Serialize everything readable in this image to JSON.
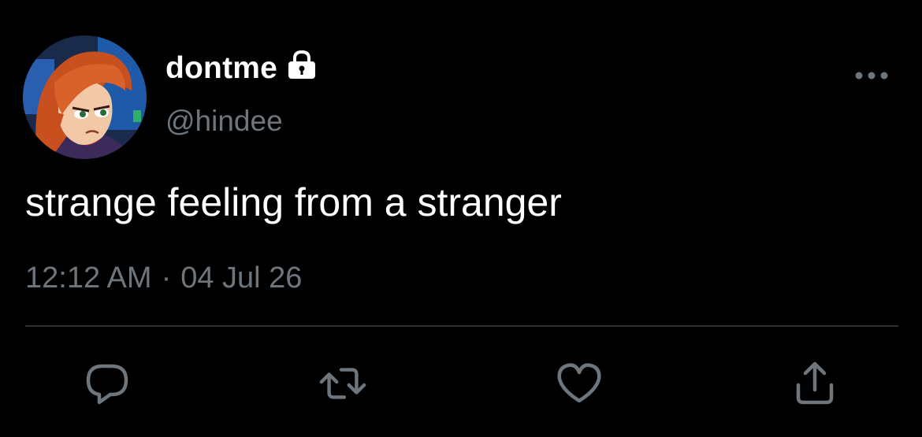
{
  "tweet": {
    "author": {
      "display_name": "dontme",
      "handle": "@hindee",
      "protected_icon": "lock-icon",
      "avatar": "cartoon-avatar-red-haired-girl"
    },
    "text": "strange feeling from a stranger",
    "time": "12:12 AM",
    "separator": "·",
    "date": "04 Jul 26",
    "actions": [
      {
        "name": "reply",
        "icon": "comment-icon"
      },
      {
        "name": "retweet",
        "icon": "retweet-icon"
      },
      {
        "name": "like",
        "icon": "heart-icon"
      },
      {
        "name": "share",
        "icon": "share-icon"
      }
    ],
    "more_icon": "more-horizontal-icon"
  },
  "colors": {
    "background": "#000000",
    "primary_text": "#ffffff",
    "secondary_text": "#6e767d",
    "divider": "#2f3336",
    "icon": "#6e767d"
  }
}
